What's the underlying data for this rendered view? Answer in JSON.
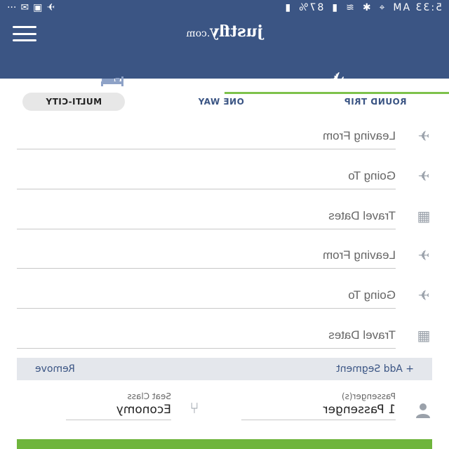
{
  "status_bar": {
    "time": "5:33 AM",
    "battery": "87%"
  },
  "app": {
    "logo": "justfly",
    "logo_suffix": ".com"
  },
  "tabs": {
    "flights_icon": "airplane-icon",
    "hotels_icon": "bed-icon"
  },
  "trip_types": {
    "round_trip": "ROUND TRIP",
    "one_way": "ONE WAY",
    "multi_city": "MULTI-CITY",
    "selected": "MULTI-CITY"
  },
  "segments": [
    {
      "leaving_from": "Leaving From",
      "going_to": "Going To",
      "travel_dates": "Travel Dates"
    },
    {
      "leaving_from": "Leaving From",
      "going_to": "Going To",
      "travel_dates": "Travel Dates"
    }
  ],
  "segment_actions": {
    "add": "+ Add Segment",
    "remove": "Remove"
  },
  "passengers": {
    "label": "Passenger(s)",
    "value": "1 Passenger"
  },
  "seat_class": {
    "label": "Seat Class",
    "value": "Economy"
  },
  "colors": {
    "header": "#3b5584",
    "accent": "#7dc24b",
    "search_button": "#6fb53c"
  }
}
